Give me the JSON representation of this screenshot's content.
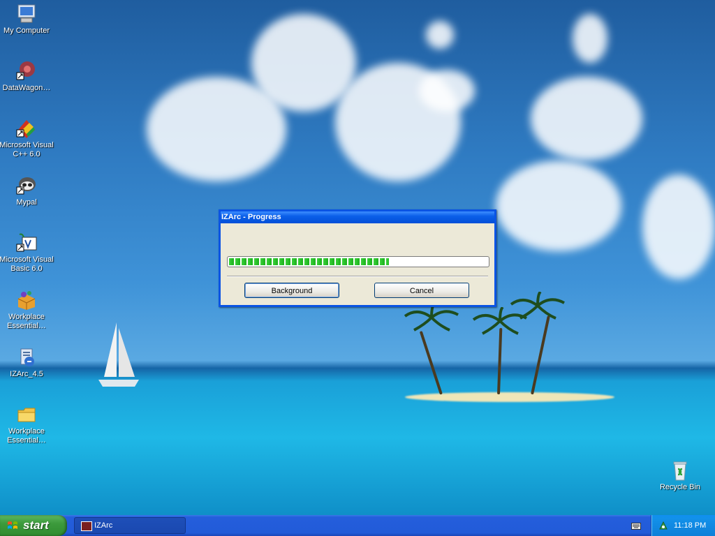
{
  "desktop": {
    "icons": [
      {
        "label": "My Computer",
        "icon": "my-computer-icon"
      },
      {
        "label": "DataWagon…",
        "icon": "datawagon-icon"
      },
      {
        "label": "Microsoft Visual C++ 6.0",
        "icon": "visual-cpp-icon"
      },
      {
        "label": "Mypal",
        "icon": "mypal-icon"
      },
      {
        "label": "Microsoft Visual Basic 6.0",
        "icon": "visual-basic-icon"
      },
      {
        "label": "Workplace Essential…",
        "icon": "workplace-essentials-icon"
      },
      {
        "label": "IZArc_4.5",
        "icon": "izarc-installer-icon"
      },
      {
        "label": "Workplace Essential…",
        "icon": "folder-icon"
      }
    ],
    "recycle_bin": {
      "label": "Recycle Bin",
      "icon": "recycle-bin-icon"
    }
  },
  "dialog": {
    "title": "IZArc - Progress",
    "progress": 0.62,
    "buttons": {
      "background": "Background",
      "cancel": "Cancel"
    }
  },
  "taskbar": {
    "start_label": "start",
    "tasks": [
      {
        "label": "IZArc"
      }
    ],
    "clock": "11:18 PM"
  },
  "colors": {
    "titlebar": "#0a5ee8",
    "progress_fill": "#1fb41f",
    "taskbar": "#245edc",
    "start": "#3c9a3c",
    "tray": "#0e7fd8"
  }
}
